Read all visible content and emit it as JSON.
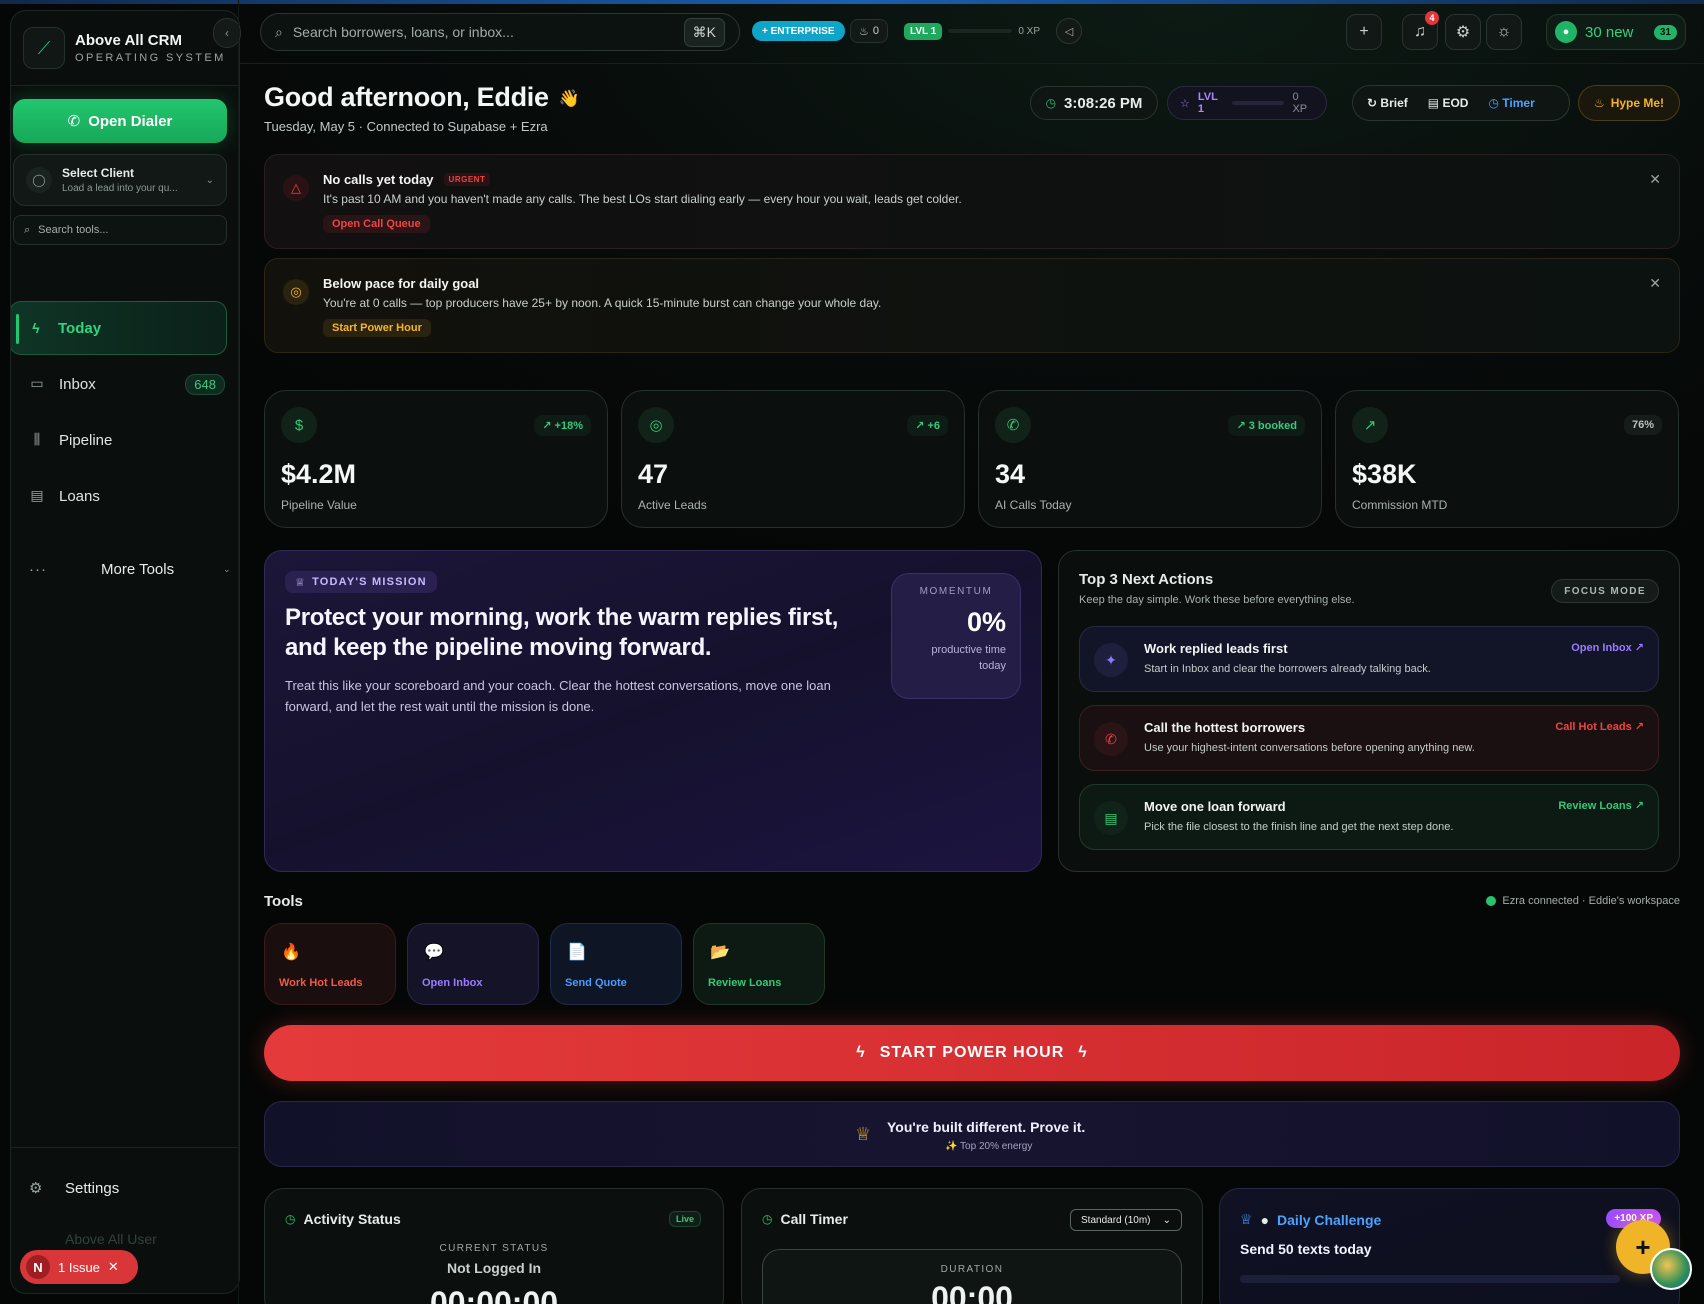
{
  "sidebar": {
    "brand_title": "Above All CRM",
    "brand_subtitle": "OPERATING SYSTEM",
    "open_dialer": "Open Dialer",
    "select_client_title": "Select Client",
    "select_client_sub": "Load a lead into your qu...",
    "search_placeholder": "Search tools...",
    "nav": [
      {
        "label": "Today"
      },
      {
        "label": "Inbox",
        "badge": "648"
      },
      {
        "label": "Pipeline"
      },
      {
        "label": "Loans"
      }
    ],
    "more_tools": "More Tools",
    "settings": "Settings",
    "user_name": "Above All User",
    "issue_letter": "N",
    "issue_label": "1 Issue"
  },
  "topbar": {
    "search_placeholder": "Search borrowers, loans, or inbox...",
    "kbd": "⌘K",
    "enterprise": "+ ENTERPRISE",
    "streak": "0",
    "level": "LVL 1",
    "xp": "0 XP",
    "notifications": "4",
    "new_label": "30 new",
    "new_count": "31"
  },
  "greeting": {
    "title": "Good afternoon, Eddie",
    "wave": "👋",
    "subtitle": "Tuesday, May 5 · Connected to Supabase + Ezra",
    "clock": "3:08:26 PM",
    "level": "LVL 1",
    "xp": "0 XP",
    "brief": "Brief",
    "eod": "EOD",
    "timer": "Timer",
    "hype": "Hype Me!"
  },
  "alerts": [
    {
      "title": "No calls yet today",
      "tag": "URGENT",
      "message": "It's past 10 AM and you haven't made any calls. The best LOs start dialing early — every hour you wait, leads get colder.",
      "action": "Open Call Queue"
    },
    {
      "title": "Below pace for daily goal",
      "message": "You're at 0 calls — top producers have 25+ by noon. A quick 15-minute burst can change your whole day.",
      "action": "Start Power Hour"
    }
  ],
  "stats": [
    {
      "value": "$4.2M",
      "label": "Pipeline Value",
      "delta": "↗ +18%"
    },
    {
      "value": "47",
      "label": "Active Leads",
      "delta": "↗ +6"
    },
    {
      "value": "34",
      "label": "AI Calls Today",
      "delta": "↗ 3 booked"
    },
    {
      "value": "$38K",
      "label": "Commission MTD",
      "delta": "76%"
    }
  ],
  "mission": {
    "tag": "TODAY'S MISSION",
    "headline": "Protect your morning, work the warm replies first, and keep the pipeline moving forward.",
    "body": "Treat this like your scoreboard and your coach. Clear the hottest conversations, move one loan forward, and let the rest wait until the mission is done.",
    "momentum_label": "MOMENTUM",
    "momentum_value": "0%",
    "momentum_sub": "productive time today"
  },
  "next_actions": {
    "title": "Top 3 Next Actions",
    "subtitle": "Keep the day simple. Work these before everything else.",
    "focus": "FOCUS MODE",
    "items": [
      {
        "title": "Work replied leads first",
        "desc": "Start in Inbox and clear the borrowers already talking back.",
        "link": "Open Inbox ↗"
      },
      {
        "title": "Call the hottest borrowers",
        "desc": "Use your highest-intent conversations before opening anything new.",
        "link": "Call Hot Leads ↗"
      },
      {
        "title": "Move one loan forward",
        "desc": "Pick the file closest to the finish line and get the next step done.",
        "link": "Review Loans ↗"
      }
    ]
  },
  "tools": {
    "title": "Tools",
    "status": "Ezra connected · Eddie's workspace",
    "items": [
      {
        "label": "Work Hot Leads",
        "icon": "🔥"
      },
      {
        "label": "Open Inbox",
        "icon": "💬"
      },
      {
        "label": "Send Quote",
        "icon": "📄"
      },
      {
        "label": "Review Loans",
        "icon": "📂"
      }
    ]
  },
  "power_hour": "START POWER HOUR",
  "prove": {
    "title": "You're built different. Prove it.",
    "subtitle": "✨ Top 20% energy"
  },
  "activity": {
    "title": "Activity Status",
    "live": "Live",
    "status_label": "CURRENT STATUS",
    "status_value": "Not Logged In",
    "time": "00:00:00"
  },
  "call_timer": {
    "title": "Call Timer",
    "mode": "Standard (10m)",
    "duration_label": "DURATION",
    "duration": "00:00"
  },
  "challenge": {
    "title": "Daily Challenge",
    "xp": "+100 XP",
    "task": "Send 50 texts today"
  }
}
